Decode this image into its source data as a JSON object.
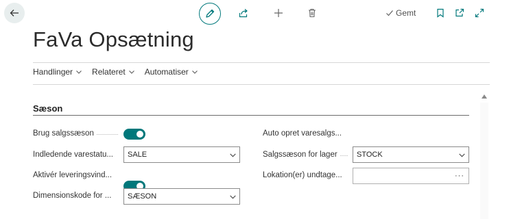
{
  "toolbar": {
    "saved_label": "Gemt",
    "icons": [
      "back-arrow-icon",
      "edit-pencil-icon",
      "share-icon",
      "plus-icon",
      "trash-icon",
      "bookmark-icon",
      "open-new-window-icon",
      "expand-icon"
    ]
  },
  "page": {
    "title": "FaVa Opsætning"
  },
  "actions": [
    {
      "label": "Handlinger"
    },
    {
      "label": "Relateret"
    },
    {
      "label": "Automatiser"
    }
  ],
  "section": {
    "title": "Sæson",
    "left_fields": [
      {
        "label": "Brug salgssæson",
        "type": "toggle",
        "value": "on"
      },
      {
        "label": "Indledende varestatu...",
        "type": "select",
        "value": "SALE"
      },
      {
        "label": "Aktivér leveringsvind...",
        "type": "toggle",
        "value": "on"
      },
      {
        "label": "Dimensionskode for ...",
        "type": "select",
        "value": "SÆSON"
      }
    ],
    "right_fields": [
      {
        "label": "Auto opret varesalgs...",
        "type": "toggle",
        "value": "on"
      },
      {
        "label": "Salgssæson for lager",
        "type": "select",
        "value": "STOCK"
      },
      {
        "label": "Lokation(er) undtage...",
        "type": "lookup",
        "value": "",
        "lookup_glyph": "···"
      }
    ]
  },
  "colors": {
    "accent": "#00787b",
    "text": "#212121"
  }
}
